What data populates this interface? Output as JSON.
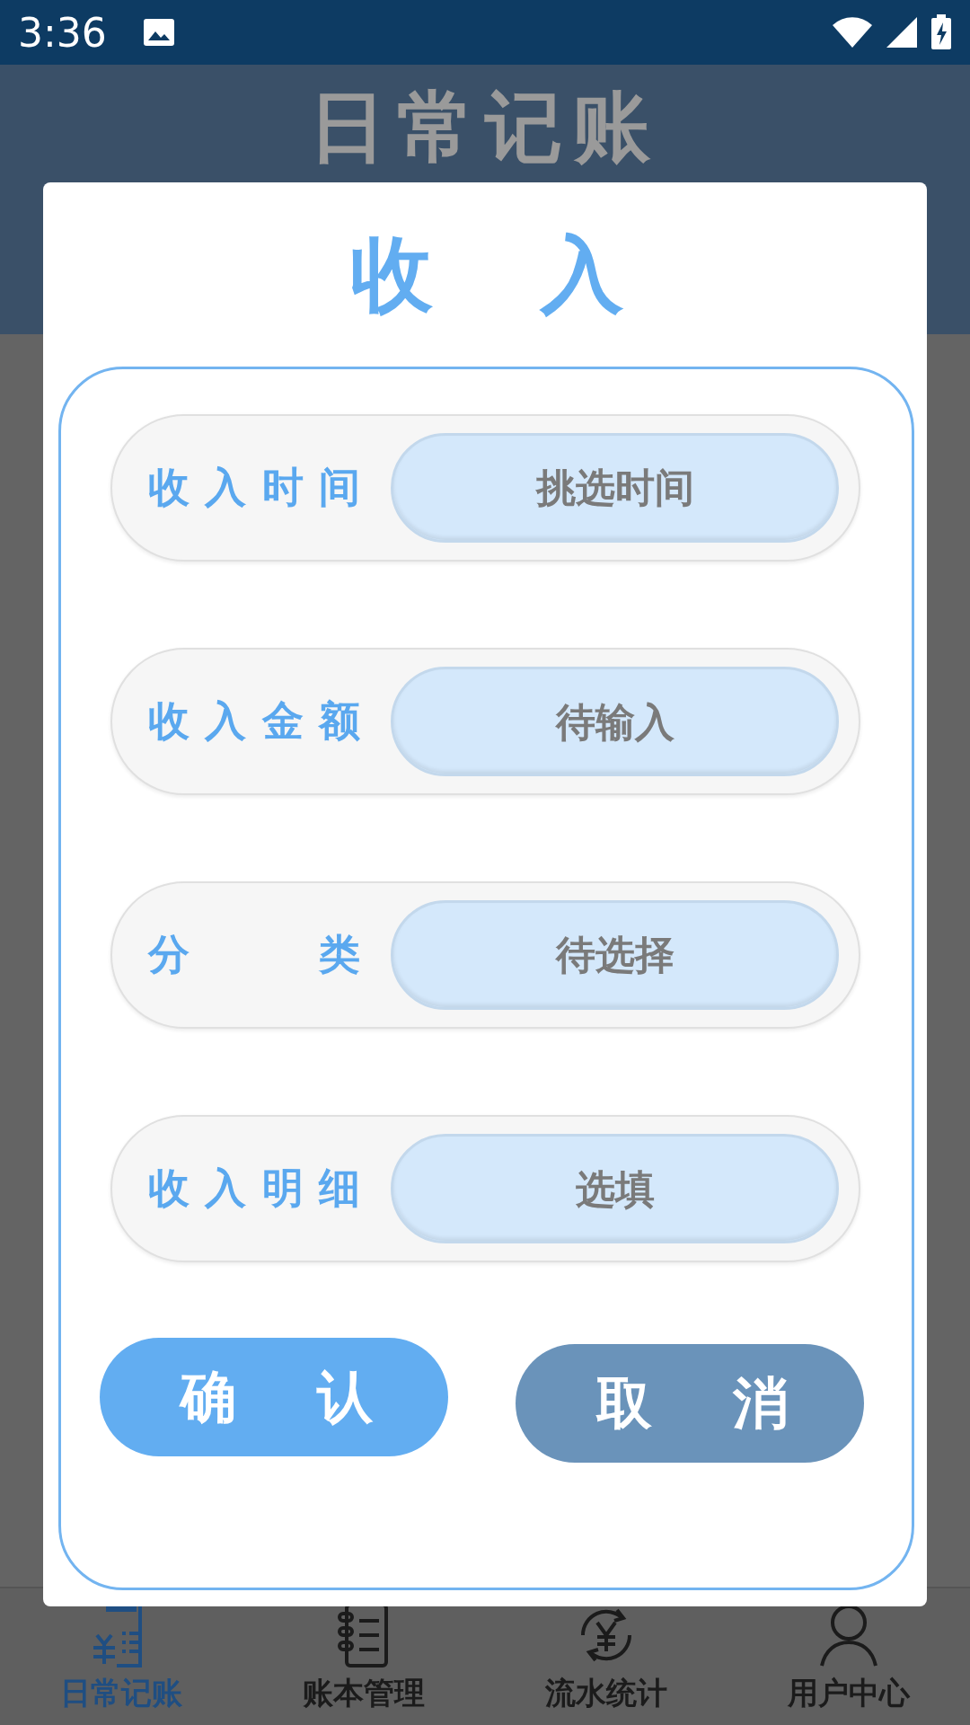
{
  "status_bar": {
    "time": "3:36"
  },
  "background_page": {
    "title": "日常记账"
  },
  "dialog": {
    "title": "收入",
    "rows": [
      {
        "label": "收入时间",
        "kind": "picker",
        "placeholder": "挑选时间"
      },
      {
        "label": "收入金额",
        "kind": "input",
        "placeholder": "待输入"
      },
      {
        "label": "分类",
        "kind": "picker",
        "placeholder": "待选择"
      },
      {
        "label": "收入明细",
        "kind": "input",
        "placeholder": "选填"
      }
    ],
    "buttons": [
      {
        "label": "确认",
        "kind": "primary"
      },
      {
        "label": "取消",
        "kind": "secondary"
      }
    ]
  },
  "bottom_nav": [
    {
      "label": "日常记账",
      "selected": true
    },
    {
      "label": "账本管理",
      "selected": false
    },
    {
      "label": "流水统计",
      "selected": false
    },
    {
      "label": "用户中心",
      "selected": false
    }
  ]
}
